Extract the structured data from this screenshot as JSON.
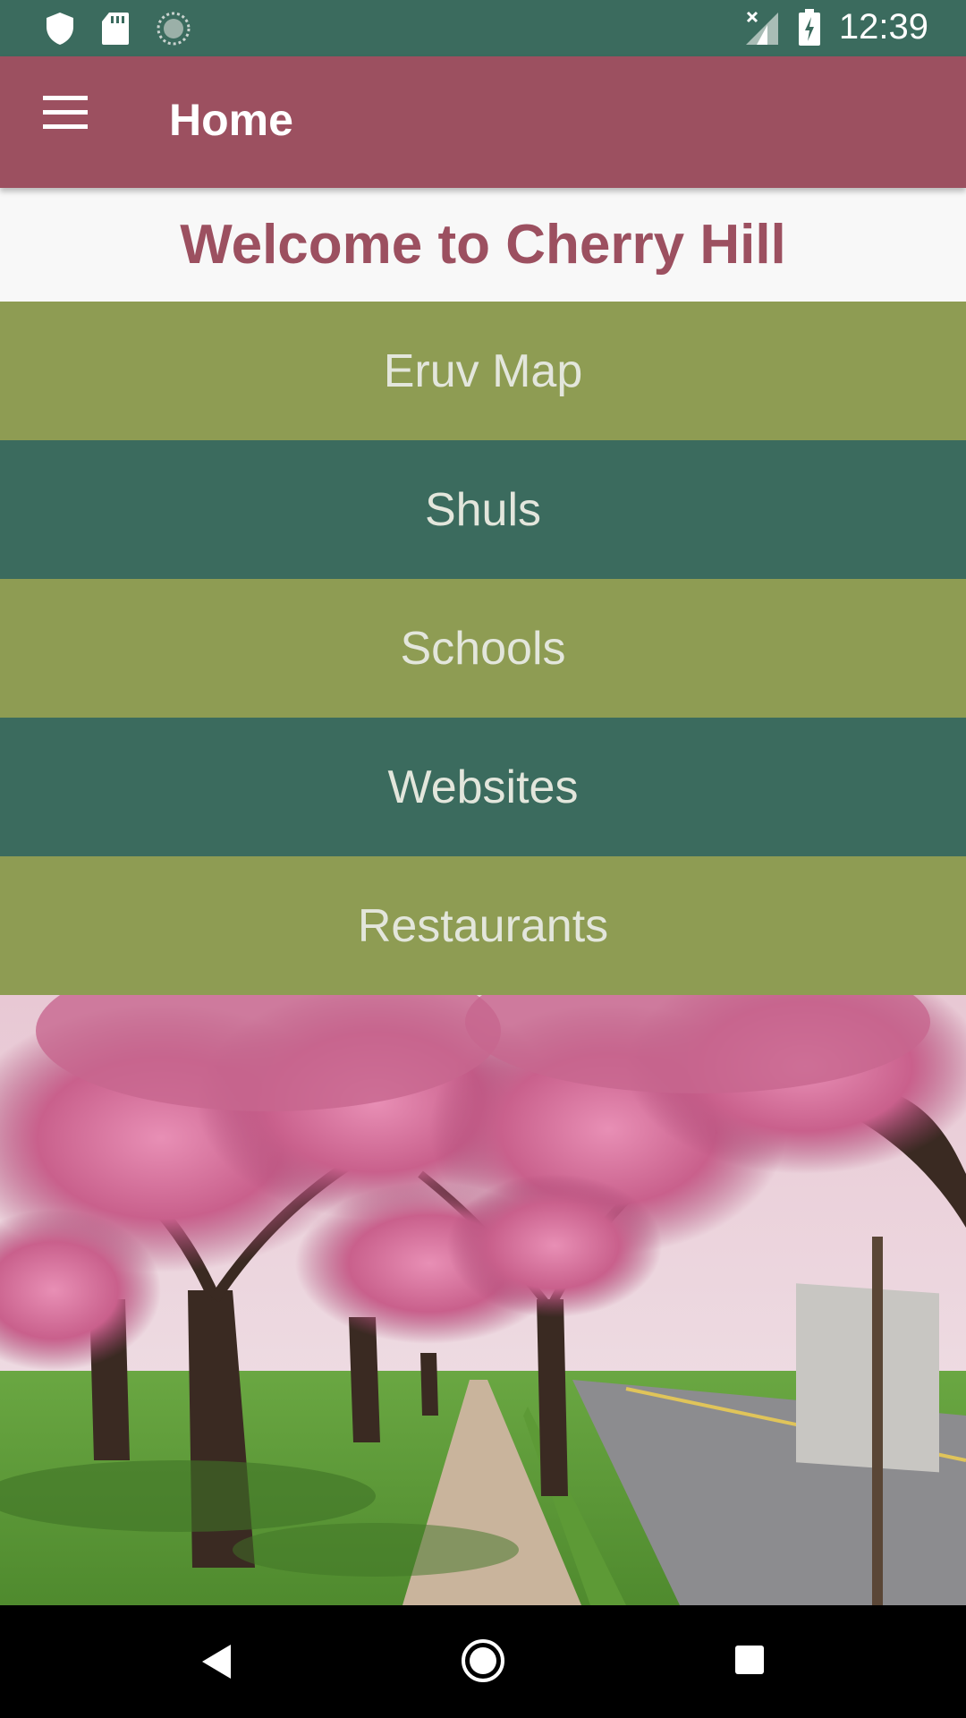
{
  "status_bar": {
    "time": "12:39",
    "icons": [
      "shield-icon",
      "sd-card-icon",
      "sync-icon",
      "signal-icon",
      "battery-charging-icon"
    ]
  },
  "app_bar": {
    "title": "Home",
    "menu_icon": "hamburger-menu-icon"
  },
  "welcome": {
    "text": "Welcome to Cherry Hill"
  },
  "menu": {
    "items": [
      {
        "label": "Eruv Map"
      },
      {
        "label": "Shuls"
      },
      {
        "label": "Schools"
      },
      {
        "label": "Websites"
      },
      {
        "label": "Restaurants"
      }
    ]
  },
  "photo": {
    "subject": "cherry-blossom-street-photo"
  },
  "colors": {
    "status_bar": "#3b6b5e",
    "app_bar": "#9c5060",
    "olive": "#8e9c53",
    "teal": "#3b6b5e",
    "welcome_text": "#9c5060"
  },
  "system_nav": {
    "icons": [
      "back-icon",
      "home-icon",
      "recents-icon"
    ]
  }
}
